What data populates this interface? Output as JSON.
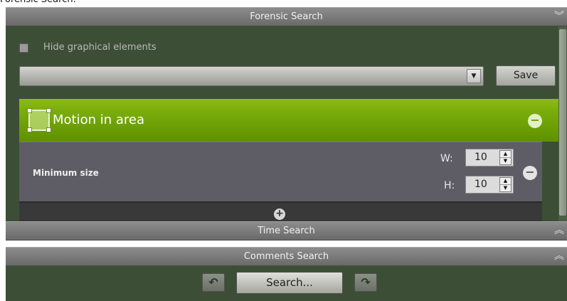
{
  "window_title": "Forensic Search:",
  "sections": {
    "forensic": "Forensic Search",
    "time": "Time Search",
    "comments": "Comments Search"
  },
  "forensic_panel": {
    "hide_graphics_label": "Hide graphical elements",
    "hide_graphics_checked": false,
    "preset_value": "",
    "save_label": "Save",
    "condition": {
      "title": "Motion in area",
      "min_size_label": "Minimum size",
      "width_label": "W:",
      "width_value": "10",
      "height_label": "H:",
      "height_value": "10"
    }
  },
  "bottom": {
    "search_label": "Search..."
  },
  "icons": {
    "collapse": "chevron-double-down-icon",
    "expand": "chevron-double-up-icon",
    "remove": "minus-circle-icon",
    "add": "plus-circle-icon",
    "undo": "undo-arrow-icon",
    "redo": "redo-arrow-icon"
  },
  "colors": {
    "panel_bg": "#3d4e37",
    "condition_header": "#7aad0b",
    "condition_body": "#5e5c65"
  }
}
